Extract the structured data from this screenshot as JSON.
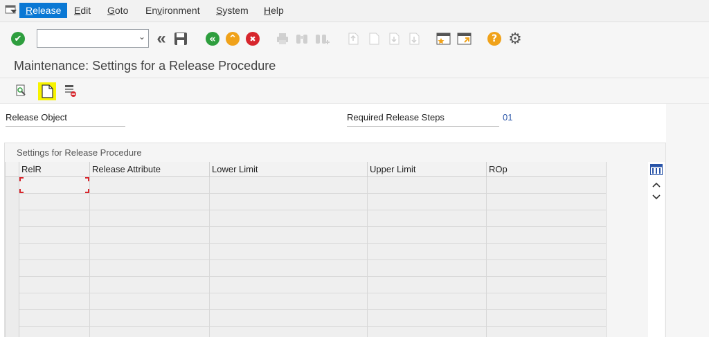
{
  "menubar": {
    "items": [
      {
        "pre": "",
        "u": "R",
        "post": "elease"
      },
      {
        "pre": "",
        "u": "E",
        "post": "dit"
      },
      {
        "pre": "",
        "u": "G",
        "post": "oto"
      },
      {
        "pre": "En",
        "u": "v",
        "post": "ironment"
      },
      {
        "pre": "",
        "u": "S",
        "post": "ystem"
      },
      {
        "pre": "",
        "u": "H",
        "post": "elp"
      }
    ]
  },
  "toolbar": {
    "command_field_value": "",
    "enter_glyph": "✔",
    "back_glyph": "«",
    "nav_back_glyph": "«",
    "exit_glyph": "⌃",
    "cancel_glyph": "✖",
    "help_glyph": "?",
    "settings_glyph": "⚙"
  },
  "page": {
    "title": "Maintenance: Settings for a Release Procedure"
  },
  "header_fields": {
    "release_object_label": "Release Object",
    "required_steps_label": "Required Release Steps",
    "required_steps_value": "01"
  },
  "group": {
    "title": "Settings for Release Procedure"
  },
  "table": {
    "columns": [
      "RelR",
      "Release Attribute",
      "Lower Limit",
      "Upper Limit",
      "ROp"
    ]
  },
  "colors": {
    "menu_active": "#0a78d4",
    "enter_green": "#2e9e3e",
    "nav_green": "#2e9e3e",
    "exit_orange": "#f0a21a",
    "cancel_red": "#d7262d",
    "help_orange": "#f0a21a",
    "highlight_yellow": "#f7f300",
    "value_blue": "#2a55a8"
  }
}
